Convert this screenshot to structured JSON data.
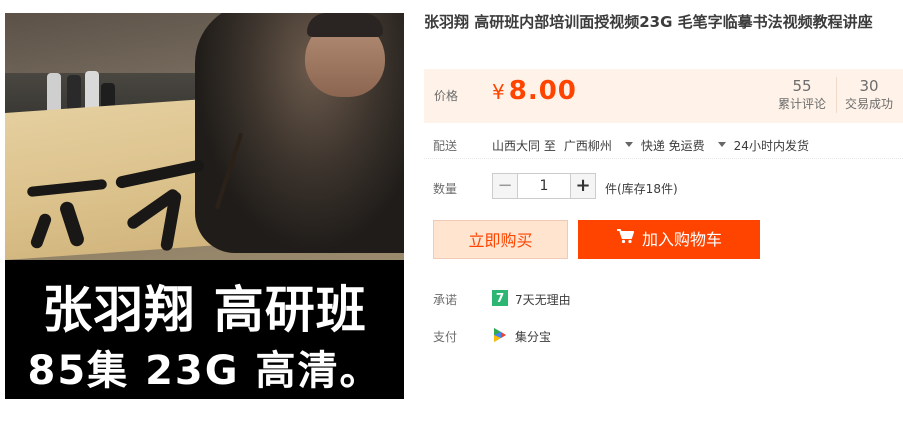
{
  "product": {
    "title": "张羽翔 高研班内部培训面授视频23G 毛笔字临摹书法视频教程讲座",
    "image": {
      "caption_line1": "张羽翔 高研班",
      "caption_line2": "85集 23G 高清。"
    }
  },
  "price": {
    "label": "价格",
    "currency": "¥",
    "value": "8.00",
    "reviews_count": "55",
    "reviews_label": "累计评论",
    "sold_count": "30",
    "sold_label": "交易成功"
  },
  "shipping": {
    "label": "配送",
    "from": "山西大同 至",
    "to": "广西柳州",
    "method": "快递 免运费",
    "dispatch": "24小时内发货"
  },
  "quantity": {
    "label": "数量",
    "minus": "−",
    "value": "1",
    "plus": "+",
    "stock_text": "件(库存18件)"
  },
  "actions": {
    "buy_now": "立即购买",
    "add_to_cart": "加入购物车"
  },
  "promise": {
    "label": "承诺",
    "badge": "7",
    "text": "7天无理由"
  },
  "payment": {
    "label": "支付",
    "text": "集分宝"
  },
  "colors": {
    "accent": "#ff4400",
    "price_panel_bg": "#fff2e8",
    "buy_now_bg": "#ffe4d0",
    "badge_green": "#2bb673"
  }
}
